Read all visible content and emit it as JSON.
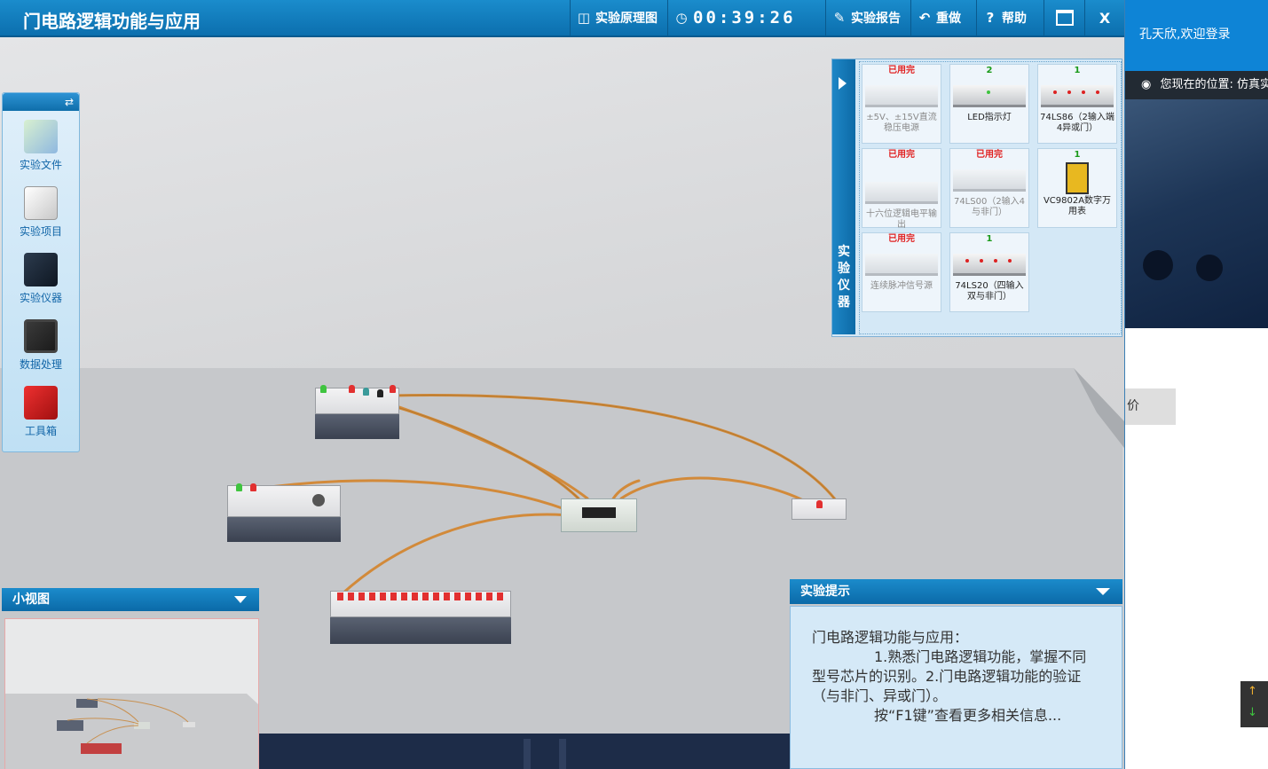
{
  "window": {
    "title": "门电路逻辑功能与应用",
    "principle_label": "实验原理图",
    "timer": "00:39:26",
    "report_label": "实验报告",
    "redo_label": "重做",
    "help_label": "帮助",
    "help_glyph": "?",
    "close_glyph": "X"
  },
  "toolbox": {
    "items": [
      {
        "label": "实验文件",
        "icon": "experiment-file-icon"
      },
      {
        "label": "实验项目",
        "icon": "experiment-project-icon"
      },
      {
        "label": "实验仪器",
        "icon": "instrument-monitor-icon"
      },
      {
        "label": "数据处理",
        "icon": "data-chart-icon"
      },
      {
        "label": "工具箱",
        "icon": "toolbox-icon"
      }
    ]
  },
  "instruments": {
    "tab_label": "实验仪器",
    "cards": [
      {
        "count": "已用完",
        "name": "±5V、±15V直流稳压电源",
        "used": true
      },
      {
        "count": "2",
        "name": "LED指示灯",
        "used": false
      },
      {
        "count": "1",
        "name": "74LS86（2输入端4异或门）",
        "used": false
      },
      {
        "count": "已用完",
        "name": "十六位逻辑电平输出",
        "used": true
      },
      {
        "count": "已用完",
        "name": "74LS00（2输入4与非门）",
        "used": true
      },
      {
        "count": "1",
        "name": "VC9802A数字万用表",
        "used": false
      },
      {
        "count": "已用完",
        "name": "连续脉冲信号源",
        "used": true
      },
      {
        "count": "1",
        "name": "74LS20（四输入双与非门）",
        "used": false
      }
    ]
  },
  "minimap": {
    "title": "小视图"
  },
  "hints": {
    "title": "实验提示",
    "line1": "门电路逻辑功能与应用：",
    "line2": "1.熟悉门电路逻辑功能，掌握不同型号芯片的识别。2.门电路逻辑功能的验证（与非门、异或门）。",
    "line3": "按“F1键”查看更多相关信息..."
  },
  "background_page": {
    "welcome": "孔天欣,欢迎登录",
    "location": "您现在的位置: 仿真实",
    "tab_partial": "价",
    "scroll_up": "↑",
    "scroll_down": "↓"
  },
  "colors": {
    "title_blue": "#0c6fae",
    "wire": "#d28a3a",
    "used": "#e02020",
    "available": "#1a9a1a"
  }
}
